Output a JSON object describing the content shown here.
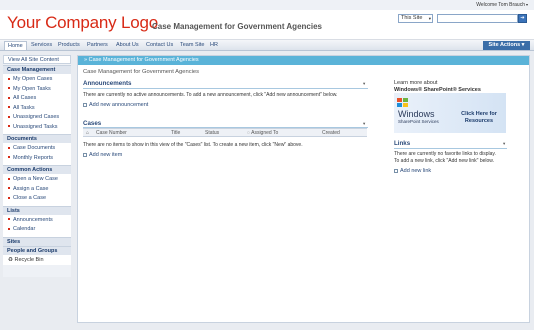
{
  "header": {
    "logo": "Your Company Logo",
    "site_title": "Case Management for Government Agencies",
    "welcome": "Welcome Tom Brauch",
    "search_scope": "This Site"
  },
  "nav": {
    "tabs": [
      "Home",
      "Services",
      "Products",
      "Partners",
      "About Us",
      "Contact Us",
      "Team Site",
      "HR"
    ],
    "site_actions": "Site Actions"
  },
  "quicklaunch": {
    "view_all": "View All Site Content",
    "sections": [
      {
        "title": "Case Management",
        "items": [
          "My Open Cases",
          "My Open Tasks",
          "All Cases",
          "All Tasks",
          "Unassigned Cases",
          "Unassigned Tasks"
        ]
      },
      {
        "title": "Documents",
        "items": [
          "Case Documents",
          "Monthly Reports"
        ]
      },
      {
        "title": "Common Actions",
        "items": [
          "Open a New Case",
          "Assign a Case",
          "Close a Case"
        ]
      },
      {
        "title": "Lists",
        "items": [
          "Announcements",
          "Calendar"
        ]
      },
      {
        "title": "Sites",
        "items": []
      },
      {
        "title": "People and Groups",
        "items": []
      }
    ],
    "recycle_bin": "Recycle Bin"
  },
  "main": {
    "breadcrumb": "Case Management for Government Agencies",
    "page_title": "Case Management for Government Agencies",
    "announcements": {
      "title": "Announcements",
      "empty_text": "There are currently no active announcements. To add a new announcement, click \"Add new announcement\" below.",
      "add_link": "Add new announcement"
    },
    "cases": {
      "title": "Cases",
      "columns": [
        "Case Number",
        "Title",
        "Status",
        "Assigned To",
        "Created"
      ],
      "empty_text": "There are no items to show in this view of the \"Cases\" list. To create a new item, click \"New\" above.",
      "add_link": "Add new item"
    },
    "wss": {
      "title_line1": "Learn more about",
      "title_line2": "Windows® SharePoint® Services",
      "logo_word": "Windows",
      "logo_sub": "SharePoint Services",
      "click_line1": "Click Here for",
      "click_line2": "Resources"
    },
    "links": {
      "title": "Links",
      "empty_line1": "There are currently no favorite links to display.",
      "empty_line2": "To add a new link, click \"Add new link\" below.",
      "add_link": "Add new link"
    }
  }
}
